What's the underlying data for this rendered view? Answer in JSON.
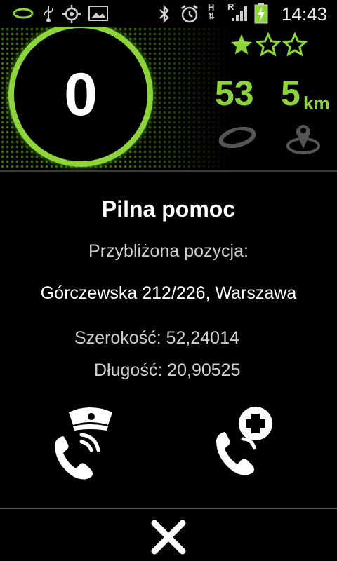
{
  "status_bar": {
    "time": "14:43",
    "icons": [
      "app-logo-icon",
      "usb-icon",
      "gps-icon",
      "image-icon",
      "bluetooth-icon",
      "alarm-icon",
      "hspa-icon",
      "roaming-signal-icon",
      "battery-charging-icon"
    ],
    "network_h": "H",
    "network_r": "R"
  },
  "header": {
    "counter": "0",
    "rating": {
      "filled": 1,
      "total": 3
    },
    "speed": "53",
    "distance": "5",
    "distance_unit": "km",
    "accent_color": "#8cd43a"
  },
  "content": {
    "title": "Pilna pomoc",
    "approx_label": "Przybliżona pozycja:",
    "address": "Górczewska 212/226, Warszawa",
    "latitude": "Szerokość: 52,24014",
    "longitude": "Długość: 20,90525"
  },
  "actions": {
    "call_police_icon": "police-phone-icon",
    "call_ambulance_icon": "medical-phone-icon",
    "close_icon": "close-icon"
  }
}
